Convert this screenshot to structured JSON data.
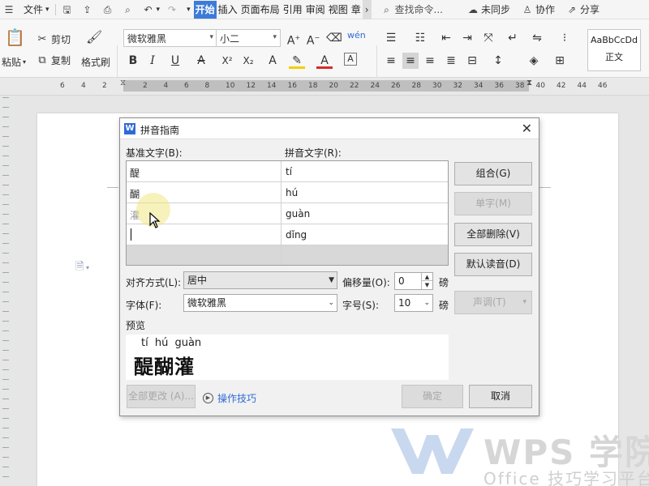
{
  "menubar": {
    "file": "文件",
    "tabs": [
      "开始",
      "插入",
      "页面布局",
      "引用",
      "审阅",
      "视图",
      "章"
    ],
    "active_tab": "开始",
    "search": "查找命令...",
    "sync": "未同步",
    "collab": "协作",
    "share": "分享"
  },
  "ribbon": {
    "paste": "粘贴",
    "cut": "剪切",
    "copy": "复制",
    "format_painter": "格式刷",
    "font_name": "微软雅黑",
    "font_size": "小二",
    "style_preview": "AaBbCcDd",
    "style_name": "正文"
  },
  "ruler": {
    "numbers": [
      "6",
      "4",
      "2",
      "2",
      "4",
      "6",
      "8",
      "10",
      "12",
      "14",
      "16",
      "18",
      "20",
      "22",
      "24",
      "26",
      "28",
      "30",
      "32",
      "34",
      "36",
      "38",
      "40",
      "42",
      "44",
      "46"
    ]
  },
  "dialog": {
    "title": "拼音指南",
    "base_text_label": "基准文字(B):",
    "pinyin_label": "拼音文字(R):",
    "rows": [
      {
        "base": "醍",
        "pinyin": "tí"
      },
      {
        "base": "醐",
        "pinyin": "hú"
      },
      {
        "base": "灌",
        "pinyin": "guàn"
      },
      {
        "base": "",
        "pinyin": "dǐng"
      }
    ],
    "buttons": {
      "group": "组合(G)",
      "single": "单字(M)",
      "clear_all": "全部删除(V)",
      "default_reading": "默认读音(D)",
      "tone": "声调(T)",
      "change_all": "全部更改 (A)...",
      "ok": "确定",
      "cancel": "取消"
    },
    "align_label": "对齐方式(L):",
    "align_value": "居中",
    "offset_label": "偏移量(O):",
    "offset_value": "0",
    "offset_unit": "磅",
    "font_label": "字体(F):",
    "font_value": "微软雅黑",
    "size_label": "字号(S):",
    "size_value": "10",
    "size_unit": "磅",
    "preview_label": "预览",
    "preview_pinyin": "tí hú guàn",
    "preview_chars": "醍醐灌",
    "tips": "操作技巧"
  },
  "watermark": {
    "brand": "WPS 学院",
    "subtitle": "Office 技巧学习平台"
  }
}
